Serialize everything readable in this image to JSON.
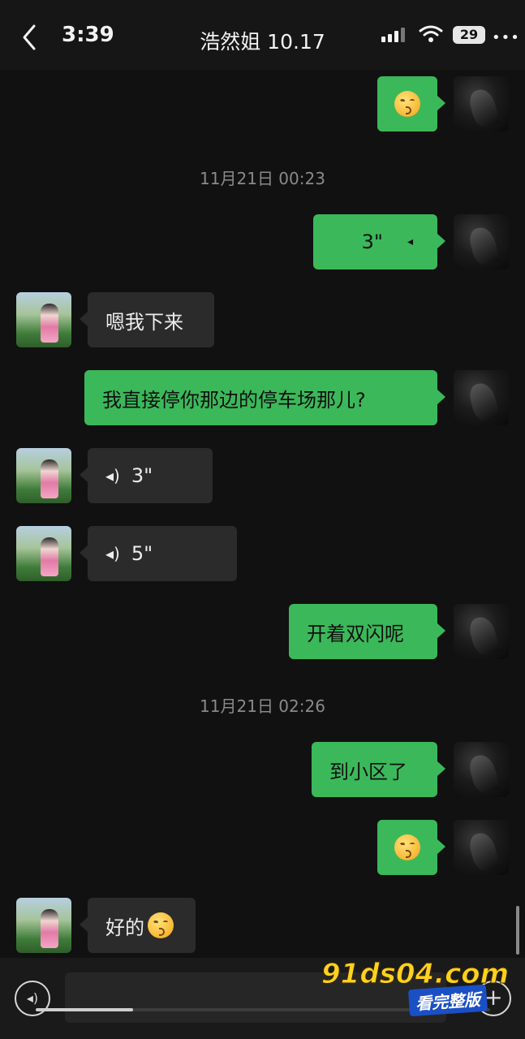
{
  "status_bar": {
    "time": "3:39",
    "battery": "29",
    "more": "•••"
  },
  "header": {
    "back_icon": "chevron-left",
    "title": "浩然姐 10.17"
  },
  "messages": {
    "m1": {
      "sender": "me",
      "type": "emoji"
    },
    "ts1": "11月21日 00:23",
    "m2": {
      "sender": "me",
      "type": "voice",
      "duration": "3\""
    },
    "m3": {
      "sender": "her",
      "type": "text",
      "text": "嗯我下来"
    },
    "m4": {
      "sender": "me",
      "type": "text",
      "text": "我直接停你那边的停车场那儿?"
    },
    "m5": {
      "sender": "her",
      "type": "voice",
      "duration": "3\""
    },
    "m6": {
      "sender": "her",
      "type": "voice",
      "duration": "5\""
    },
    "m7": {
      "sender": "me",
      "type": "text",
      "text": "开着双闪呢"
    },
    "ts2": "11月21日 02:26",
    "m8": {
      "sender": "me",
      "type": "text",
      "text": "到小区了"
    },
    "m9": {
      "sender": "me",
      "type": "emoji"
    },
    "m10": {
      "sender": "her",
      "type": "text",
      "text": "好的"
    }
  },
  "input_bar": {
    "voice_icon": "voice-wave",
    "placeholder": "",
    "plus_icon": "+"
  },
  "watermark": {
    "main": "91ds04.com",
    "sub": "看完整版"
  },
  "colors": {
    "outgoing_bubble": "#3bb85a",
    "incoming_bubble": "#2b2b2b",
    "background": "#111111"
  }
}
